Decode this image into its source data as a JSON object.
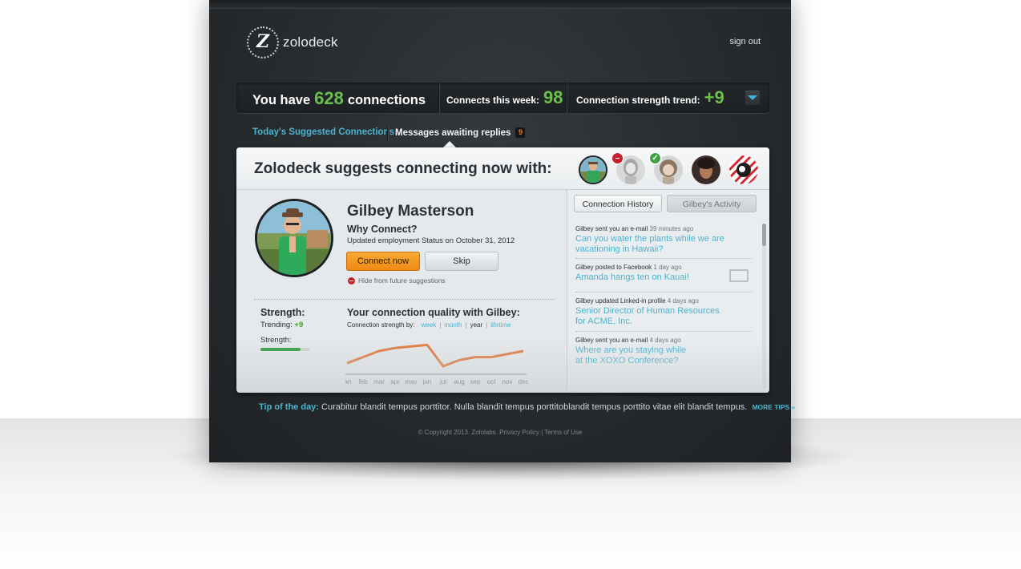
{
  "app": {
    "logo_glyph": "Z",
    "logo_text": "zolodeck",
    "sign_out": "sign out"
  },
  "stats": {
    "connections_prefix": "You have",
    "connections_value": "628",
    "connections_suffix": "connections",
    "week_label": "Connects this week:",
    "week_value": "98",
    "trend_label": "Connection strength trend:",
    "trend_value": "+9"
  },
  "tabs": {
    "suggested": "Today's Suggested Connections",
    "messages": "Messages awaiting replies",
    "messages_count": "9"
  },
  "card": {
    "title": "Zolodeck suggests connecting now with:",
    "thumbs": [
      {
        "name": "gilbey",
        "selected": true
      },
      {
        "name": "person-2",
        "badge": "declined"
      },
      {
        "name": "person-3",
        "badge": "accepted"
      },
      {
        "name": "person-4"
      },
      {
        "name": "person-5"
      }
    ]
  },
  "person": {
    "name": "Gilbey Masterson",
    "why_heading": "Why Connect?",
    "why_detail": "Updated employment Status on October 31, 2012",
    "connect_label": "Connect now",
    "skip_label": "Skip",
    "hide_label": "Hide from future suggestions"
  },
  "strength": {
    "heading": "Strength:",
    "trending_label": "Trending:",
    "trending_value": "+9",
    "strength_label": "Strength:",
    "strength_level": 0.8
  },
  "quality": {
    "heading": "Your connection quality with Gilbey:",
    "by_label": "Connection strength by:",
    "options": [
      "week",
      "month",
      "year",
      "lifetime"
    ],
    "active_option": "year"
  },
  "chart_data": {
    "type": "line",
    "title": "",
    "xlabel": "",
    "ylabel": "",
    "categories": [
      "jan",
      "feb",
      "mar",
      "apr",
      "may",
      "jun",
      "jul",
      "aug",
      "sep",
      "oct",
      "nov",
      "dec"
    ],
    "series": [
      {
        "values": [
          1,
          3,
          5,
          6,
          6.5,
          7,
          0,
          2,
          3,
          3,
          4,
          5
        ]
      }
    ],
    "ylim": [
      0,
      10
    ],
    "grid": false,
    "line_color": "#e07b3e"
  },
  "history": {
    "tab_active": "Connection History",
    "tab_inactive": "Gilbey's Activity",
    "items": [
      {
        "meta": "Gilbey sent you an e-mail",
        "time": "39 minutes ago",
        "text": "Can you water the plants while we are vacationing in Hawaii?"
      },
      {
        "meta": "Gilbey posted to Facebook",
        "time": "1 day ago",
        "text": "Amanda hangs ten on Kauai!"
      },
      {
        "meta": "Gilbey updated Linked-in profile",
        "time": "4 days ago",
        "text": "Senior Director of Human Resources for ACME, Inc."
      },
      {
        "meta": "Gilbey sent you an e-mail",
        "time": "4 days ago",
        "text": "Where are you staying while at the XOXO Conference?"
      }
    ]
  },
  "tip": {
    "label": "Tip of the day:",
    "text": "Curabitur blandit tempus porttitor. Nulla blandit tempus porttitoblandit tempus porttito vitae elit blandit tempus.",
    "more": "MORE TIPS »"
  },
  "footer": {
    "copyright": "© Copyright 2013. Zololabs.",
    "privacy": "Privacy Policy",
    "separator": "|",
    "terms": "Terms of Use"
  },
  "colors": {
    "accent": "#4ab3cf",
    "green": "#6bc04b",
    "orange": "#ee8a14",
    "background": "#272b2e"
  }
}
